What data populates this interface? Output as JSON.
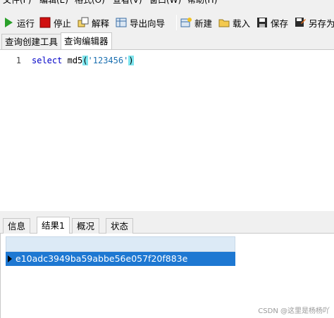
{
  "menu": {
    "items": [
      {
        "label": "文件(F)"
      },
      {
        "label": "编辑(E)"
      },
      {
        "label": "格式(O)"
      },
      {
        "label": "查看(V)"
      },
      {
        "label": "窗口(W)"
      },
      {
        "label": "帮助(H)"
      }
    ]
  },
  "toolbar": {
    "run_label": "运行",
    "stop_label": "停止",
    "explain_label": "解释",
    "export_wizard_label": "导出向导",
    "new_label": "新建",
    "load_label": "载入",
    "save_label": "保存",
    "save_as_label": "另存为"
  },
  "query_tabs": {
    "builder_label": "查询创建工具",
    "editor_label": "查询编辑器"
  },
  "editor": {
    "line_number": "1",
    "keyword": "select",
    "function": "md5",
    "open_paren": "(",
    "string_literal": "'123456'",
    "close_paren": ")"
  },
  "result_tabs": {
    "info_label": "信息",
    "result_label": "结果1",
    "profile_label": "概况",
    "status_label": "状态"
  },
  "results": {
    "rows": [
      {
        "value": "e10adc3949ba59abbe56e057f20f883e"
      }
    ]
  },
  "colors": {
    "selection": "#1e78d2",
    "header": "#dceaf6",
    "keyword": "#0000c8"
  },
  "watermark": "CSDN @这里是杨杨吖"
}
